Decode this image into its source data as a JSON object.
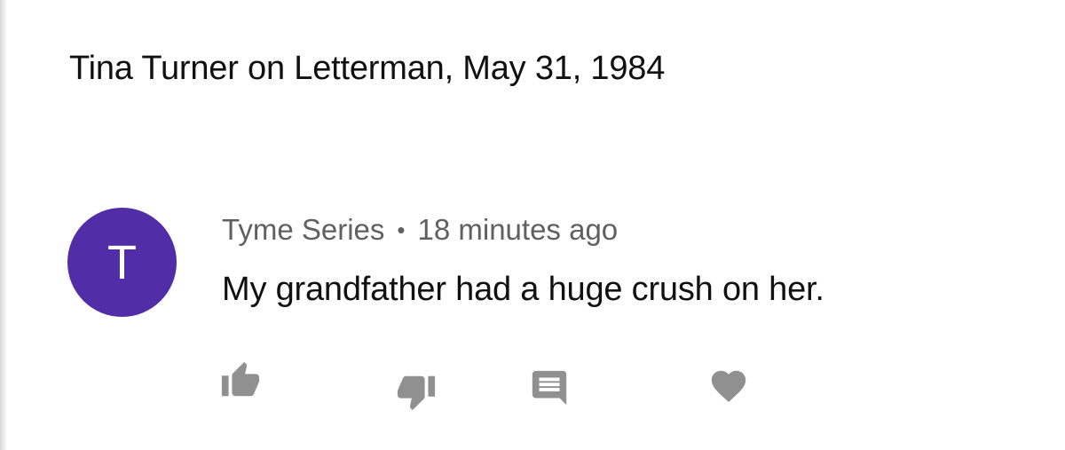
{
  "video": {
    "title": "Tina Turner on Letterman, May 31, 1984"
  },
  "comment": {
    "avatar_letter": "T",
    "avatar_color": "#512da8",
    "author": "Tyme Series",
    "separator": "•",
    "timestamp": "18 minutes ago",
    "text": "My grandfather had a huge crush on her."
  },
  "actions": {
    "icons": [
      "thumbs-up-icon",
      "thumbs-down-icon",
      "reply-comment-icon",
      "heart-icon"
    ],
    "icon_color": "#909090"
  }
}
